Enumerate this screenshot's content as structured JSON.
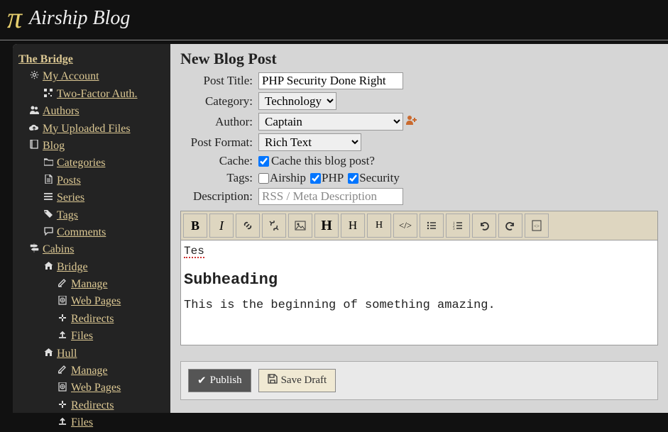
{
  "header": {
    "title": "Airship Blog"
  },
  "sidebar": {
    "root": "The Bridge",
    "items": [
      {
        "label": "My Account",
        "level": 1,
        "icon": "gear"
      },
      {
        "label": "Two-Factor Auth.",
        "level": 2,
        "icon": "qr"
      },
      {
        "label": "Authors",
        "level": 1,
        "icon": "users"
      },
      {
        "label": "My Uploaded Files",
        "level": 1,
        "icon": "cloud"
      },
      {
        "label": "Blog",
        "level": 1,
        "icon": "book"
      },
      {
        "label": "Categories",
        "level": 2,
        "icon": "folder"
      },
      {
        "label": "Posts",
        "level": 2,
        "icon": "file"
      },
      {
        "label": "Series",
        "level": 2,
        "icon": "list"
      },
      {
        "label": "Tags",
        "level": 2,
        "icon": "tag"
      },
      {
        "label": "Comments",
        "level": 2,
        "icon": "comment"
      },
      {
        "label": "Cabins",
        "level": 1,
        "icon": "signpost"
      },
      {
        "label": "Bridge",
        "level": 2,
        "icon": "home"
      },
      {
        "label": "Manage",
        "level": 3,
        "icon": "edit"
      },
      {
        "label": "Web Pages",
        "level": 3,
        "icon": "globe"
      },
      {
        "label": "Redirects",
        "level": 3,
        "icon": "cross"
      },
      {
        "label": "Files",
        "level": 3,
        "icon": "upload"
      },
      {
        "label": "Hull",
        "level": 2,
        "icon": "home"
      },
      {
        "label": "Manage",
        "level": 3,
        "icon": "edit"
      },
      {
        "label": "Web Pages",
        "level": 3,
        "icon": "globe"
      },
      {
        "label": "Redirects",
        "level": 3,
        "icon": "cross"
      },
      {
        "label": "Files",
        "level": 3,
        "icon": "upload"
      }
    ]
  },
  "form": {
    "heading": "New Blog Post",
    "labels": {
      "title": "Post Title:",
      "category": "Category:",
      "author": "Author:",
      "format": "Post Format:",
      "cache": "Cache:",
      "tags": "Tags:",
      "description": "Description:"
    },
    "values": {
      "title": "PHP Security Done Right",
      "category": "Technology",
      "author": "Captain",
      "format": "Rich Text",
      "cache_label": "Cache this blog post?",
      "cache_checked": true,
      "description_placeholder": "RSS / Meta Description"
    },
    "tags": [
      {
        "label": "Airship",
        "checked": false
      },
      {
        "label": "PHP",
        "checked": true
      },
      {
        "label": "Security",
        "checked": true
      }
    ]
  },
  "editor": {
    "line1": "Tes",
    "subheading": "Subheading",
    "paragraph": "This is the beginning of something amazing."
  },
  "actions": {
    "publish": "Publish",
    "save_draft": "Save Draft"
  },
  "icons": {
    "gear": "✿",
    "qr": "▩",
    "users": "👥",
    "cloud": "☁",
    "book": "▤",
    "folder": "▭",
    "file": "▯",
    "list": "≡",
    "tag": "🏷",
    "comment": "💬",
    "signpost": "⛗",
    "home": "⌂",
    "edit": "✎",
    "globe": "❍",
    "cross": "✕",
    "upload": "⬆"
  }
}
